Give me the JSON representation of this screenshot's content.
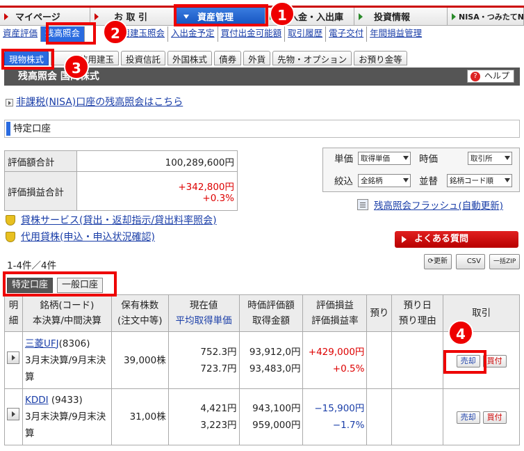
{
  "top_nav": {
    "items": [
      {
        "label": "マイページ"
      },
      {
        "label": "お 取 引"
      },
      {
        "label": "資産管理"
      },
      {
        "label": "入金・入出庫"
      },
      {
        "label": "投資情報"
      },
      {
        "label": "NISA・つみたてNISA"
      }
    ]
  },
  "sub_nav": {
    "items": [
      {
        "label": "資産評価"
      },
      {
        "label": "残高照会"
      },
      {
        "label": "信用建玉照会"
      },
      {
        "label": "入出金予定"
      },
      {
        "label": "買付出金可能額"
      },
      {
        "label": "取引履歴"
      },
      {
        "label": "電子交付"
      },
      {
        "label": "年間損益管理"
      }
    ]
  },
  "asset_tabs": {
    "items": [
      {
        "label": "現物株式"
      },
      {
        "label": "信用建玉"
      },
      {
        "label": "投資信託"
      },
      {
        "label": "外国株式"
      },
      {
        "label": "債券"
      },
      {
        "label": "外貨"
      },
      {
        "label": "先物・オプション"
      },
      {
        "label": "お預り金等"
      }
    ]
  },
  "page_title": "残高照会 国内株式",
  "help_label": "ヘルプ",
  "nisa_link": "非課税(NISA)口座の残高照会はこちら",
  "account_header": "特定口座",
  "summary": {
    "valuation_label": "評価額合計",
    "valuation_value": "100,289,600円",
    "pl_label": "評価損益合計",
    "pl_value": "+342,800円",
    "pl_rate": "+0.3%"
  },
  "filters": {
    "unit_price_label": "単価",
    "unit_price_value": "取得単価",
    "market_price_label": "時価",
    "market_price_value": "取引所",
    "narrow_label": "絞込",
    "narrow_value": "全銘柄",
    "sort_label": "並替",
    "sort_value": "銘柄コード順"
  },
  "flash_link": "残高照会フラッシュ(自動更新)",
  "services": {
    "lending_link": "貸株サービス(貸出・返却指示/貸出料率照会)",
    "margin_lending_link": "代用貸株(申込・申込状況確認)"
  },
  "faq_label": "よくある質問",
  "result_count": "1-4件／4件",
  "tools": {
    "refresh": "更新",
    "csv": "CSV",
    "zip": "一括ZIP"
  },
  "account_tabs": [
    {
      "label": "特定口座"
    },
    {
      "label": "一般口座"
    }
  ],
  "table": {
    "headers": {
      "detail": "明細",
      "name": "銘柄(コード)",
      "name_sub": "本決算/中間決算",
      "qty": "保有株数",
      "qty_sub": "(注文中等)",
      "price": "現在値",
      "price_sub": "平均取得単価",
      "mv": "時価評価額",
      "mv_sub": "取得金額",
      "pl": "評価損益",
      "pl_sub": "評価損益率",
      "deposit": "預り",
      "deposit_date": "預り日",
      "deposit_reason": "預り理由",
      "trade": "取引"
    },
    "rows": [
      {
        "name": "三菱UFJ",
        "code": "(8306)",
        "fiscal": "3月末決算/9月末決算",
        "qty": "39,000株",
        "price": "752.3円",
        "avg_cost": "723.7円",
        "market_value": "93,912,0円",
        "cost": "93,483,0円",
        "pl": "+429,000円",
        "pl_rate": "+0.5%",
        "sell": "売却",
        "buy": "買付"
      },
      {
        "name": "KDDI",
        "code": "(9433)",
        "fiscal": "3月末決算/9月末決算",
        "qty": "31,00株",
        "price": "4,421円",
        "avg_cost": "3,223円",
        "market_value": "943,100円",
        "cost": "959,000円",
        "pl": "−15,900円",
        "pl_rate": "−1.7%",
        "sell": "売却",
        "buy": "買付"
      }
    ]
  },
  "callouts": [
    "1",
    "2",
    "3",
    "4"
  ],
  "colors": {
    "accent": "#e00000",
    "nav_active": "#1553c0",
    "link": "#1a3ea8"
  }
}
